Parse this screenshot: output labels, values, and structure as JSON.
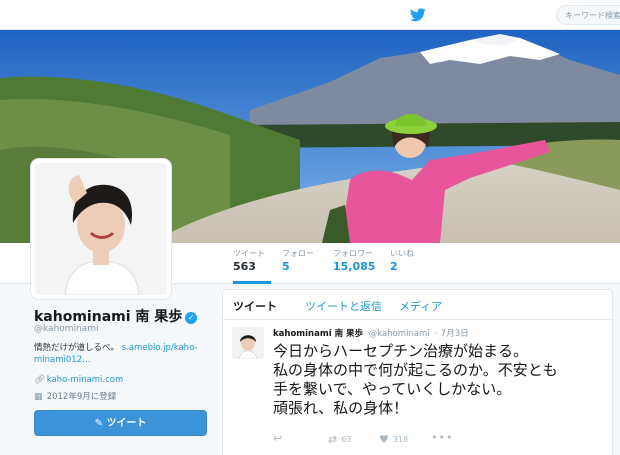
{
  "search": {
    "placeholder": "キーワード検索"
  },
  "stats": {
    "tweets": {
      "label": "ツイート",
      "value": "563"
    },
    "following": {
      "label": "フォロー",
      "value": "5"
    },
    "followers": {
      "label": "フォロワー",
      "value": "15,085"
    },
    "likes": {
      "label": "いいね",
      "value": "2"
    }
  },
  "profile": {
    "name": "kahominami 南 果歩",
    "handle": "@kahominami",
    "bio_text": "情熱だけが道しるべ。",
    "bio_link": "s.ameblo.jp/kaho-minami012…",
    "url": "kaho-minami.com",
    "joined": "2012年9月に登録",
    "tweet_button": "ツイート"
  },
  "tabs": [
    "ツイート",
    "ツイートと返信",
    "メディア"
  ],
  "tweet": {
    "name": "kahominami 南 果歩",
    "handle": "@kahominami",
    "time": "7月3日",
    "lines": [
      "今日からハーセプチン治療が始まる。",
      "私の身体の中で何が起こるのか。不安とも",
      "手を繋いで、やっていくしかない。",
      "頑張れ、私の身体！"
    ],
    "retweets": "63",
    "likes": "318"
  },
  "icons": {
    "logo": "twitter-bird-icon",
    "verified": "verified-badge-icon",
    "link": "link-icon",
    "calendar": "calendar-icon",
    "compose": "compose-icon",
    "reply": "reply-icon",
    "retweet": "retweet-icon",
    "like": "heart-icon",
    "more": "more-icon"
  },
  "colors": {
    "accent": "#1b95e0",
    "button": "#3b94d9",
    "background": "#f5f8fa"
  }
}
